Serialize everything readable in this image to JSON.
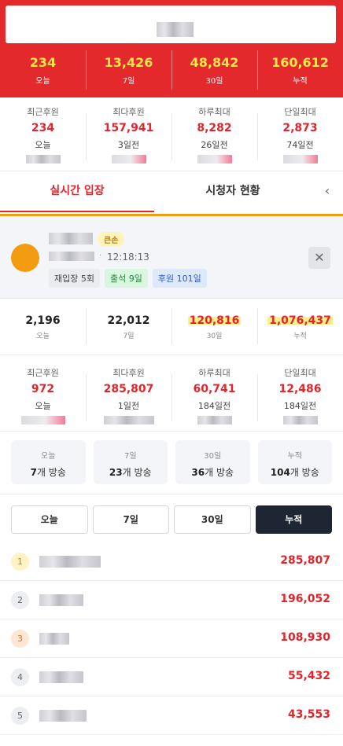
{
  "totals": [
    {
      "value": "234",
      "label": "오늘"
    },
    {
      "value": "13,426",
      "label": "7일"
    },
    {
      "value": "48,842",
      "label": "30일"
    },
    {
      "value": "160,612",
      "label": "누적"
    }
  ],
  "channel_records": [
    {
      "title": "최근후원",
      "value": "234",
      "date": "오늘"
    },
    {
      "title": "최다후원",
      "value": "157,941",
      "date": "3일전"
    },
    {
      "title": "하루최대",
      "value": "8,282",
      "date": "26일전"
    },
    {
      "title": "단일최대",
      "value": "2,873",
      "date": "74일전"
    }
  ],
  "tabs": {
    "live": "실시간 입장",
    "viewers": "시청자 현황",
    "back": "‹"
  },
  "viewer": {
    "badge": "큰손",
    "separator": "·",
    "time": "12:18:13",
    "chips": {
      "reentry": "재입장 5회",
      "attendance": "출석 9일",
      "donation": "후원 101일"
    },
    "close": "✕"
  },
  "viewer_stats": [
    {
      "value": "2,196",
      "label": "오늘"
    },
    {
      "value": "22,012",
      "label": "7일"
    },
    {
      "value": "120,816",
      "label": "30일"
    },
    {
      "value": "1,076,437",
      "label": "누적"
    }
  ],
  "viewer_records": [
    {
      "title": "최근후원",
      "value": "972",
      "date": "오늘"
    },
    {
      "title": "최다후원",
      "value": "285,807",
      "date": "1일전"
    },
    {
      "title": "하루최대",
      "value": "60,741",
      "date": "184일전"
    },
    {
      "title": "단일최대",
      "value": "12,486",
      "date": "184일전"
    }
  ],
  "broadcasts": [
    {
      "label": "오늘",
      "count": "7",
      "unit": "개 방송"
    },
    {
      "label": "7일",
      "count": "23",
      "unit": "개 방송"
    },
    {
      "label": "30일",
      "count": "36",
      "unit": "개 방송"
    },
    {
      "label": "누적",
      "count": "104",
      "unit": "개 방송"
    }
  ],
  "periods": [
    "오늘",
    "7일",
    "30일",
    "누적"
  ],
  "selected_period": "누적",
  "ranking": [
    {
      "rank": "1",
      "amount": "285,807"
    },
    {
      "rank": "2",
      "amount": "196,052"
    },
    {
      "rank": "3",
      "amount": "108,930"
    },
    {
      "rank": "4",
      "amount": "55,432"
    },
    {
      "rank": "5",
      "amount": "43,553"
    }
  ],
  "colors": {
    "brand_red": "#e4292d",
    "highlight_yellow": "#ffe64a",
    "accent_orange": "#f39c12",
    "dark_button": "#1e2533"
  }
}
